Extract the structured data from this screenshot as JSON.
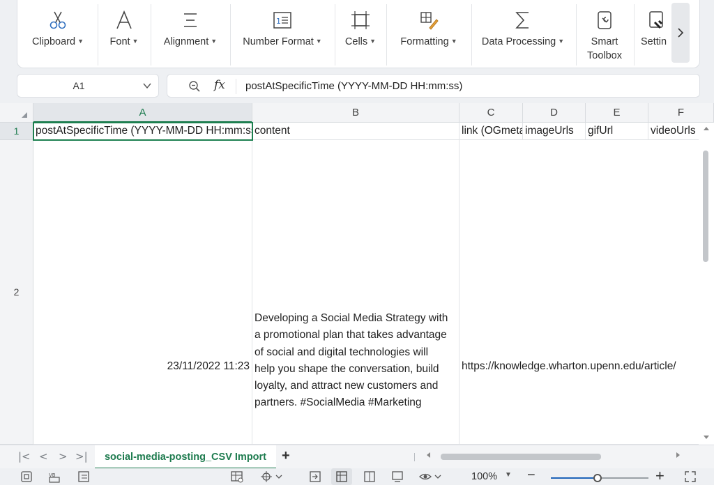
{
  "ribbon": {
    "groups": [
      {
        "label": "Clipboard",
        "icon": "scissors-icon",
        "dropdown": true
      },
      {
        "label": "Font",
        "icon": "font-letter-icon",
        "dropdown": true
      },
      {
        "label": "Alignment",
        "icon": "align-lines-icon",
        "dropdown": true
      },
      {
        "label": "Number Format",
        "icon": "number-format-icon",
        "dropdown": true
      },
      {
        "label": "Cells",
        "icon": "cell-frame-icon",
        "dropdown": true
      },
      {
        "label": "Formatting",
        "icon": "format-brush-icon",
        "dropdown": true
      },
      {
        "label": "Data Processing",
        "icon": "sigma-icon",
        "dropdown": true
      },
      {
        "label": "Smart Toolbox",
        "icon": "smart-toolbox-icon",
        "dropdown": false
      },
      {
        "label": "Settin",
        "icon": "settings-icon",
        "dropdown": false
      }
    ],
    "scroll_icon": "chevron-right-icon"
  },
  "formula_bar": {
    "name_box": "A1",
    "fx_label": "fx",
    "value": "postAtSpecificTime (YYYY-MM-DD HH:mm:ss)"
  },
  "grid": {
    "columns": [
      "A",
      "B",
      "C",
      "D",
      "E",
      "F"
    ],
    "selected_column": "A",
    "rows": [
      {
        "number": "1",
        "cells": [
          "postAtSpecificTime (YYYY-MM-DD HH:mm:ss)",
          "content",
          "link (OGmetadata)",
          "imageUrls",
          "gifUrl",
          "videoUrls"
        ]
      },
      {
        "number": "2",
        "cells": [
          "23/11/2022 11:23",
          "Developing a Social Media Strategy with a promotional plan that takes advantage of social and digital technologies will help you shape the conversation, build loyalty, and attract new customers and partners. #SocialMedia #Marketing",
          "https://knowledge.wharton.upenn.edu/article/",
          "",
          "",
          ""
        ]
      }
    ]
  },
  "sheet_tabs": {
    "active": "social-media-posting_CSV Import",
    "add_label": "+"
  },
  "status_bar": {
    "zoom": "100%",
    "zoom_fraction": 0.48
  },
  "colors": {
    "accent_green": "#1d7b4e",
    "selection_border": "#1d8050"
  }
}
